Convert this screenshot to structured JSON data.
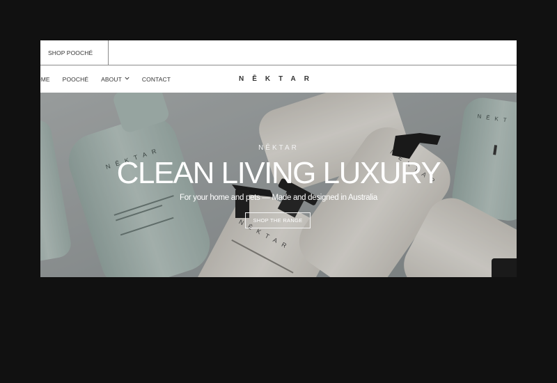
{
  "topbar": {
    "tab_label": "SHOP POOCHÉ"
  },
  "nav": {
    "items": [
      {
        "label": "OME"
      },
      {
        "label": "POOCHÉ"
      },
      {
        "label": "ABOUT",
        "has_dropdown": true
      },
      {
        "label": "CONTACT"
      }
    ],
    "logo": "NĒKTAR",
    "dropdown_icon": "chevron-down-icon"
  },
  "hero": {
    "brand": "NĒKTAR",
    "title": "CLEAN LIVING LUXURY",
    "subtitle": "For your home and pets — Made and designed in Australia",
    "button_label": "SHOP THE RANGE",
    "bottle_label": "NĒKTAR"
  },
  "colors": {
    "page_background": "#111111",
    "header_background": "#ffffff",
    "text_dark": "#333333",
    "bottle_sage": "#b9cbc6",
    "bottle_cream": "#e9e6df",
    "pump_black": "#1a1a1a"
  }
}
